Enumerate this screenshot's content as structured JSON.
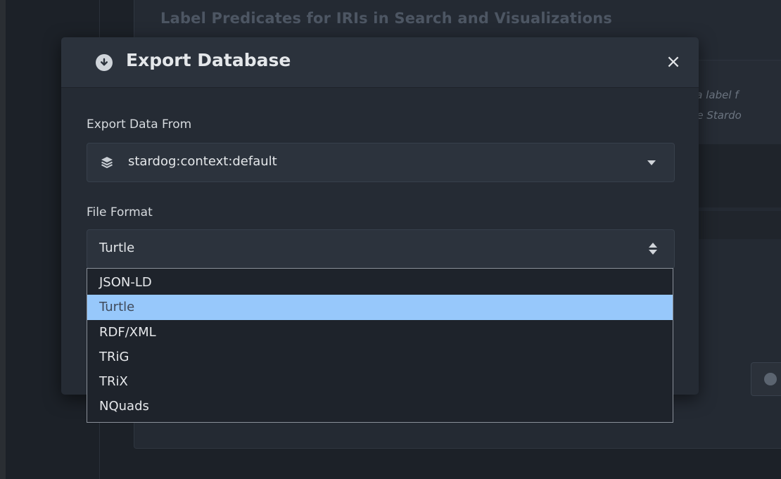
{
  "background": {
    "heading": "Label Predicates for IRIs in Search and Visualizations",
    "card_text_1": "d a label f",
    "card_text_2": "the Stardo"
  },
  "modal": {
    "title": "Export Database",
    "header_icon": "download-circle-icon",
    "close_label": "×",
    "export_from": {
      "label": "Export Data From",
      "value": "stardog:context:default",
      "icon": "layers-icon"
    },
    "file_format": {
      "label": "File Format",
      "value": "Turtle",
      "options": [
        "JSON-LD",
        "Turtle",
        "RDF/XML",
        "TRiG",
        "TRiX",
        "NQuads"
      ],
      "selected": "Turtle"
    }
  },
  "colors": {
    "modal_bg": "#252b34",
    "header_bg": "#2b323c",
    "highlight": "#97c8fb"
  }
}
